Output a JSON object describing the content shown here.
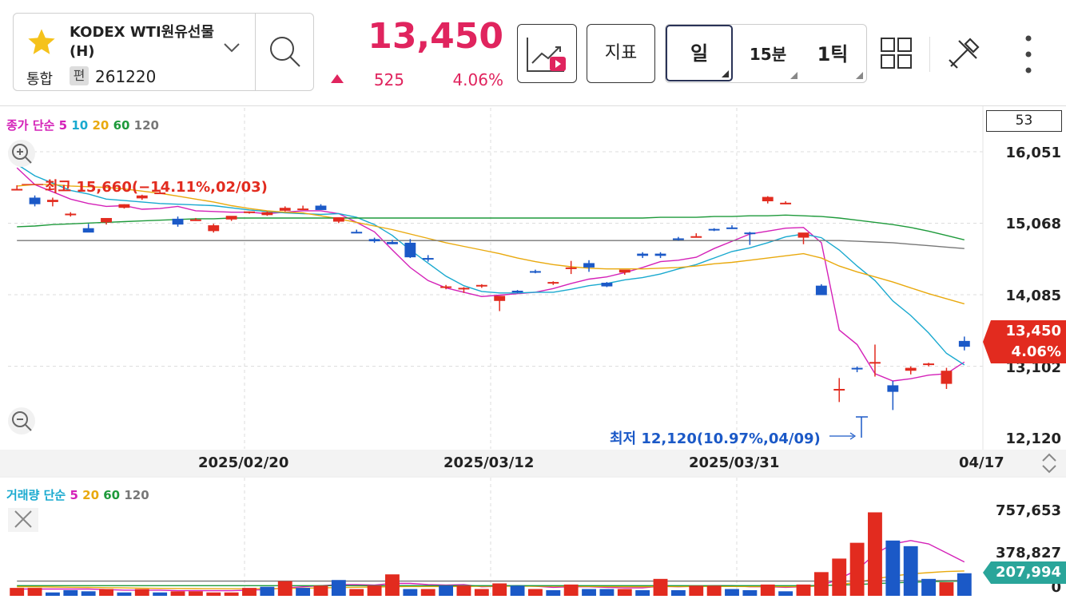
{
  "header": {
    "stock_name": "KODEX WTI원유선물(H)",
    "market": "통합",
    "badge": "편",
    "code": "261220",
    "price": "13,450",
    "change": "525",
    "change_pct": "4.06%",
    "indicator_label": "지표",
    "period_day": "일",
    "period_15min": "15분",
    "period_tick": "1틱"
  },
  "colors": {
    "up": "#e22b1f",
    "down": "#1b59c7",
    "ma5": "#d421b8",
    "ma10": "#19a9cf",
    "ma20": "#e9a90d",
    "ma60": "#1e9a3b",
    "ma120": "#777777",
    "accent": "#e0245e",
    "vol_tag": "#2aa59a"
  },
  "icons": [
    "star-icon",
    "chevron-down-icon",
    "search-icon",
    "chart-play-icon",
    "grid-icon",
    "tools-icon",
    "more-icon",
    "zoom-in-icon",
    "zoom-out-icon",
    "close-icon",
    "sort-icon"
  ],
  "price_panel": {
    "legend_title": "종가 단순",
    "legend_periods": [
      "5",
      "10",
      "20",
      "60",
      "120"
    ],
    "count_box": "53",
    "axis_labels": [
      "16,051",
      "15,068",
      "14,085",
      "13,102",
      "12,120"
    ],
    "current_price": "13,450",
    "current_pct": "4.06%",
    "high_annotation": "최고 15,660(−14.11%,02/03)",
    "low_annotation": "최저 12,120(10.97%,04/09)",
    "dates": [
      "2025/02/20",
      "2025/03/12",
      "2025/03/31",
      "04/17"
    ]
  },
  "volume_panel": {
    "legend_title": "거래량 단순",
    "legend_periods": [
      "5",
      "20",
      "60",
      "120"
    ],
    "axis_labels": [
      "757,653",
      "378,827",
      "0"
    ],
    "current_volume": "207,994"
  },
  "chart_data": [
    {
      "type": "candlestick",
      "title": "종가 단순 5 10 20 60 120",
      "ylim": [
        12120,
        16051
      ],
      "ohlc": [
        [
          15540,
          15590,
          15520,
          15540
        ],
        [
          15420,
          15450,
          15300,
          15330
        ],
        [
          15360,
          15420,
          15300,
          15390
        ],
        [
          15180,
          15220,
          15160,
          15200
        ],
        [
          15000,
          15060,
          14950,
          14940
        ],
        [
          15080,
          15130,
          15050,
          15140
        ],
        [
          15280,
          15330,
          15270,
          15330
        ],
        [
          15410,
          15460,
          15390,
          15450
        ],
        [
          15490,
          15530,
          15470,
          15490
        ],
        [
          15130,
          15160,
          15020,
          15050
        ],
        [
          15110,
          15140,
          15100,
          15120
        ],
        [
          14960,
          15060,
          14940,
          15040
        ],
        [
          15120,
          15160,
          15100,
          15170
        ],
        [
          15220,
          15230,
          15200,
          15230
        ],
        [
          15180,
          15230,
          15170,
          15220
        ],
        [
          15240,
          15300,
          15230,
          15280
        ],
        [
          15270,
          15310,
          15250,
          15270
        ],
        [
          15310,
          15330,
          15260,
          15250
        ],
        [
          15090,
          15130,
          15070,
          15150
        ],
        [
          14950,
          14980,
          14930,
          14940
        ],
        [
          14850,
          14870,
          14800,
          14820
        ],
        [
          14810,
          14840,
          14780,
          14780
        ],
        [
          14800,
          14850,
          14590,
          14600
        ],
        [
          14590,
          14630,
          14540,
          14570
        ],
        [
          14200,
          14220,
          14160,
          14200
        ],
        [
          14160,
          14190,
          14110,
          14180
        ],
        [
          14210,
          14230,
          14180,
          14220
        ],
        [
          14000,
          14040,
          13860,
          14070
        ],
        [
          14140,
          14150,
          14110,
          14130
        ],
        [
          14410,
          14430,
          14380,
          14390
        ],
        [
          14250,
          14270,
          14220,
          14260
        ],
        [
          14460,
          14550,
          14370,
          14460
        ],
        [
          14520,
          14560,
          14400,
          14460
        ],
        [
          14250,
          14260,
          14190,
          14200
        ],
        [
          14390,
          14420,
          14360,
          14430
        ],
        [
          14650,
          14670,
          14590,
          14620
        ],
        [
          14650,
          14670,
          14590,
          14620
        ],
        [
          14860,
          14880,
          14830,
          14840
        ],
        [
          14880,
          14930,
          14870,
          14890
        ],
        [
          14990,
          15000,
          14960,
          14970
        ],
        [
          15010,
          15040,
          14990,
          14990
        ],
        [
          14940,
          14950,
          14770,
          14920
        ],
        [
          15370,
          15440,
          15340,
          15430
        ],
        [
          15350,
          15370,
          15330,
          15350
        ],
        [
          14870,
          14890,
          14780,
          14940
        ],
        [
          14210,
          14230,
          14090,
          14080
        ],
        [
          12780,
          12940,
          12610,
          12790
        ],
        [
          13080,
          13100,
          13020,
          13060
        ],
        [
          13150,
          13400,
          12960,
          13160
        ],
        [
          12840,
          12900,
          12500,
          12750
        ],
        [
          13040,
          13100,
          12990,
          13080
        ],
        [
          13120,
          13150,
          13100,
          13140
        ],
        [
          12860,
          13080,
          12790,
          13040
        ],
        [
          13450,
          13510,
          13320,
          13370
        ]
      ],
      "ma_series": [
        {
          "name": "5",
          "values": [
            15830,
            15600,
            15500,
            15400,
            15340,
            15300,
            15310,
            15260,
            15270,
            15300,
            15240,
            15230,
            15220,
            15220,
            15200,
            15220,
            15240,
            15240,
            15200,
            15080,
            14950,
            14700,
            14460,
            14280,
            14180,
            14120,
            14060,
            14080,
            14100,
            14120,
            14170,
            14240,
            14300,
            14330,
            14390,
            14460,
            14540,
            14560,
            14600,
            14720,
            14820,
            14920,
            14960,
            15000,
            15010,
            14800,
            13600,
            13400,
            13000,
            12900,
            12930,
            12980,
            13000,
            13160
          ]
        },
        {
          "name": "10",
          "values": [
            15880,
            15720,
            15620,
            15520,
            15470,
            15400,
            15380,
            15360,
            15340,
            15330,
            15320,
            15310,
            15280,
            15250,
            15230,
            15210,
            15200,
            15190,
            15200,
            15150,
            15050,
            14900,
            14700,
            14520,
            14340,
            14210,
            14130,
            14110,
            14110,
            14120,
            14120,
            14160,
            14210,
            14240,
            14290,
            14320,
            14370,
            14440,
            14500,
            14590,
            14680,
            14730,
            14800,
            14880,
            14920,
            14870,
            14700,
            14480,
            14280,
            14000,
            13800,
            13560,
            13280,
            13120
          ]
        },
        {
          "name": "20",
          "values": [
            15580,
            15600,
            15600,
            15580,
            15570,
            15560,
            15540,
            15510,
            15480,
            15440,
            15400,
            15360,
            15310,
            15270,
            15240,
            15220,
            15210,
            15170,
            15130,
            15080,
            15030,
            14980,
            14920,
            14860,
            14800,
            14750,
            14700,
            14650,
            14590,
            14540,
            14500,
            14470,
            14450,
            14440,
            14440,
            14440,
            14450,
            14460,
            14480,
            14510,
            14530,
            14560,
            14590,
            14620,
            14650,
            14590,
            14480,
            14400,
            14330,
            14260,
            14180,
            14100,
            14030,
            13960
          ]
        },
        {
          "name": "60",
          "values": [
            15020,
            15030,
            15050,
            15060,
            15070,
            15080,
            15090,
            15100,
            15110,
            15120,
            15130,
            15130,
            15140,
            15140,
            15140,
            15140,
            15140,
            15140,
            15140,
            15140,
            15140,
            15140,
            15140,
            15140,
            15140,
            15140,
            15140,
            15140,
            15140,
            15140,
            15140,
            15140,
            15140,
            15140,
            15140,
            15140,
            15150,
            15150,
            15150,
            15160,
            15160,
            15170,
            15170,
            15180,
            15170,
            15160,
            15140,
            15110,
            15080,
            15050,
            15010,
            14960,
            14900,
            14840
          ]
        },
        {
          "name": "120",
          "values": [
            14830,
            14830,
            14830,
            14830,
            14830,
            14830,
            14830,
            14830,
            14830,
            14830,
            14830,
            14830,
            14830,
            14830,
            14830,
            14830,
            14830,
            14830,
            14830,
            14830,
            14830,
            14830,
            14830,
            14830,
            14830,
            14830,
            14830,
            14830,
            14830,
            14830,
            14830,
            14830,
            14830,
            14830,
            14830,
            14830,
            14830,
            14830,
            14830,
            14830,
            14830,
            14830,
            14830,
            14830,
            14830,
            14830,
            14830,
            14820,
            14810,
            14800,
            14780,
            14760,
            14740,
            14720
          ]
        }
      ],
      "xlabel": "",
      "ylabel": ""
    },
    {
      "type": "bar",
      "title": "거래량 단순 5 20 60 120",
      "ylim": [
        0,
        757653
      ],
      "values": [
        70000,
        70000,
        30000,
        50000,
        40000,
        60000,
        30000,
        60000,
        30000,
        40000,
        40000,
        30000,
        30000,
        70000,
        80000,
        130000,
        70000,
        90000,
        140000,
        60000,
        90000,
        190000,
        60000,
        60000,
        90000,
        90000,
        60000,
        110000,
        90000,
        60000,
        50000,
        100000,
        60000,
        60000,
        60000,
        50000,
        150000,
        50000,
        90000,
        90000,
        60000,
        50000,
        100000,
        40000,
        100000,
        210000,
        330000,
        470000,
        740000,
        490000,
        440000,
        150000,
        120000,
        200000
      ],
      "up": [
        true,
        true,
        false,
        false,
        false,
        true,
        false,
        true,
        false,
        true,
        true,
        true,
        true,
        true,
        false,
        true,
        false,
        true,
        false,
        true,
        true,
        true,
        false,
        true,
        false,
        true,
        true,
        true,
        false,
        true,
        false,
        true,
        false,
        false,
        true,
        false,
        true,
        false,
        true,
        true,
        false,
        false,
        true,
        false,
        true,
        true,
        true,
        true,
        true,
        false,
        false,
        false,
        true,
        false
      ],
      "ma_series": [
        {
          "name": "5",
          "values": [
            60000,
            60000,
            60000,
            60000,
            60000,
            55000,
            50000,
            50000,
            50000,
            45000,
            45000,
            45000,
            45000,
            50000,
            55000,
            70000,
            80000,
            90000,
            100000,
            100000,
            95000,
            110000,
            110000,
            100000,
            95000,
            100000,
            80000,
            85000,
            90000,
            85000,
            75000,
            80000,
            80000,
            75000,
            70000,
            70000,
            85000,
            80000,
            85000,
            90000,
            90000,
            80000,
            80000,
            75000,
            80000,
            90000,
            150000,
            230000,
            370000,
            460000,
            490000,
            460000,
            380000,
            300000
          ]
        },
        {
          "name": "20",
          "values": [
            80000,
            80000,
            78000,
            76000,
            74000,
            72000,
            70000,
            68000,
            66000,
            65000,
            64000,
            63000,
            62000,
            62000,
            63000,
            65000,
            67000,
            70000,
            73000,
            76000,
            78000,
            80000,
            82000,
            82000,
            82000,
            83000,
            84000,
            85000,
            86000,
            85000,
            84000,
            84000,
            83000,
            82000,
            81000,
            80000,
            82000,
            82000,
            82000,
            83000,
            83000,
            82000,
            82000,
            81000,
            82000,
            88000,
            100000,
            120000,
            150000,
            175000,
            195000,
            205000,
            215000,
            220000
          ]
        },
        {
          "name": "60",
          "values": [
            90000,
            90000,
            90000,
            90000,
            90000,
            90000,
            90000,
            90000,
            90000,
            90000,
            90000,
            90000,
            90000,
            90000,
            90000,
            90000,
            90000,
            90000,
            90000,
            90000,
            90000,
            90000,
            90000,
            90000,
            90000,
            90000,
            90000,
            90000,
            90000,
            90000,
            90000,
            90000,
            90000,
            90000,
            90000,
            90000,
            90000,
            90000,
            90000,
            90000,
            90000,
            90000,
            90000,
            90000,
            90000,
            92000,
            95000,
            100000,
            108000,
            115000,
            120000,
            125000,
            128000,
            130000
          ]
        },
        {
          "name": "120",
          "values": [
            130000,
            130000,
            130000,
            130000,
            130000,
            130000,
            130000,
            130000,
            130000,
            130000,
            130000,
            130000,
            130000,
            130000,
            130000,
            130000,
            130000,
            130000,
            130000,
            130000,
            130000,
            130000,
            130000,
            130000,
            130000,
            130000,
            130000,
            130000,
            130000,
            130000,
            130000,
            130000,
            130000,
            130000,
            130000,
            130000,
            130000,
            130000,
            130000,
            130000,
            130000,
            130000,
            130000,
            130000,
            130000,
            130000,
            130000,
            130000,
            132000,
            133000,
            134000,
            135000,
            135000,
            136000
          ]
        }
      ],
      "xlabel": "",
      "ylabel": ""
    }
  ]
}
